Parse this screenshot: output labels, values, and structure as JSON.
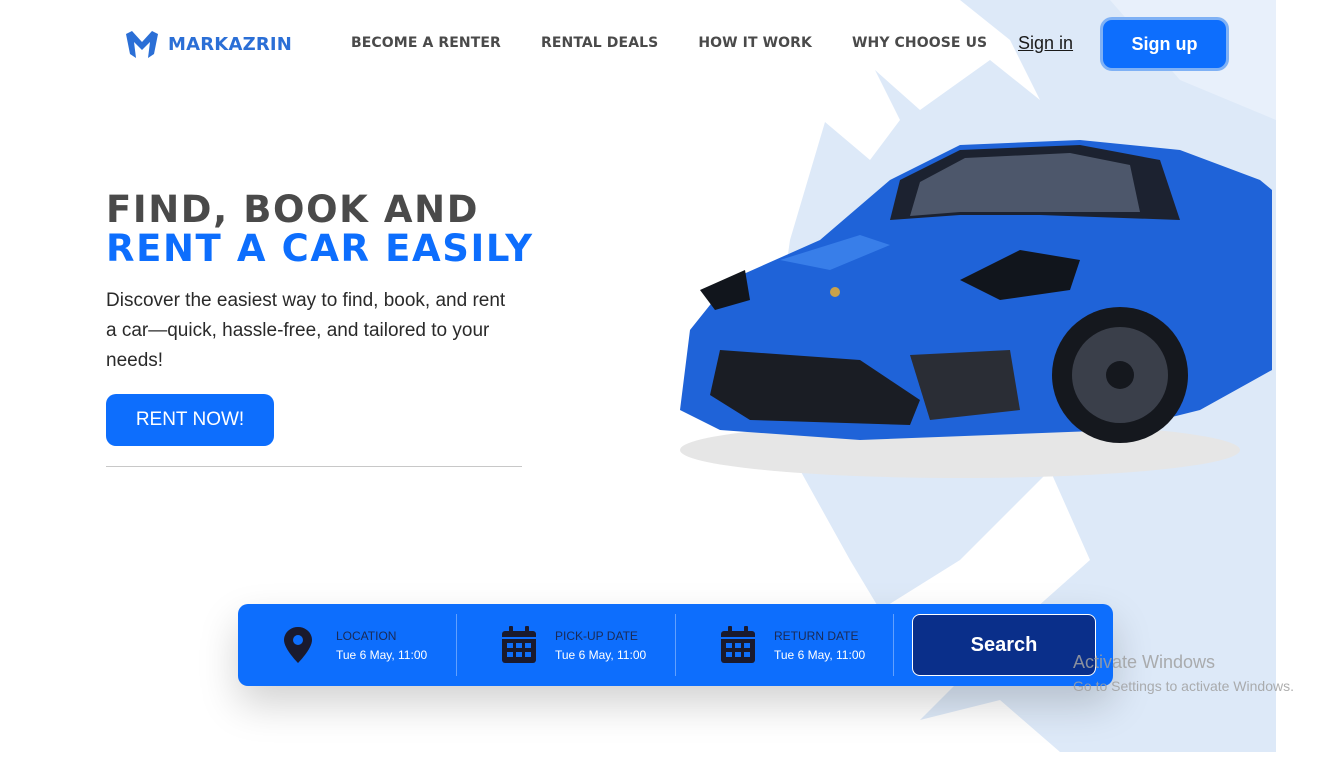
{
  "brand": {
    "name": "MARKAZRIN",
    "color": "#2b6fd6"
  },
  "nav": {
    "items": [
      "BECOME A RENTER",
      "RENTAL DEALS",
      "HOW IT WORK",
      "WHY CHOOSE US"
    ]
  },
  "auth": {
    "signin_label": "Sign in",
    "signup_label": "Sign up"
  },
  "hero": {
    "title_line1": "FIND, BOOK AND",
    "title_line2": "RENT A CAR EASILY",
    "description": "Discover the easiest way to find, book, and rent a car—quick, hassle-free, and tailored to your needs!",
    "cta_label": "RENT NOW!"
  },
  "search_bar": {
    "location": {
      "label": "LOCATION",
      "value": "Tue 6 May, 11:00",
      "icon": "map-pin-icon"
    },
    "pickup": {
      "label": "PICK-UP DATE",
      "value": "Tue 6 May, 11:00",
      "icon": "calendar-icon"
    },
    "return": {
      "label": "RETURN DATE",
      "value": "Tue 6 May, 11:00",
      "icon": "calendar-icon"
    },
    "search_label": "Search"
  },
  "watermark": {
    "line1": "Activate Windows",
    "line2": "Go to Settings to activate Windows."
  },
  "colors": {
    "accent": "#0d6efd",
    "dark_button": "#0a2f8a",
    "bg_shape": "#dbe8f8"
  }
}
